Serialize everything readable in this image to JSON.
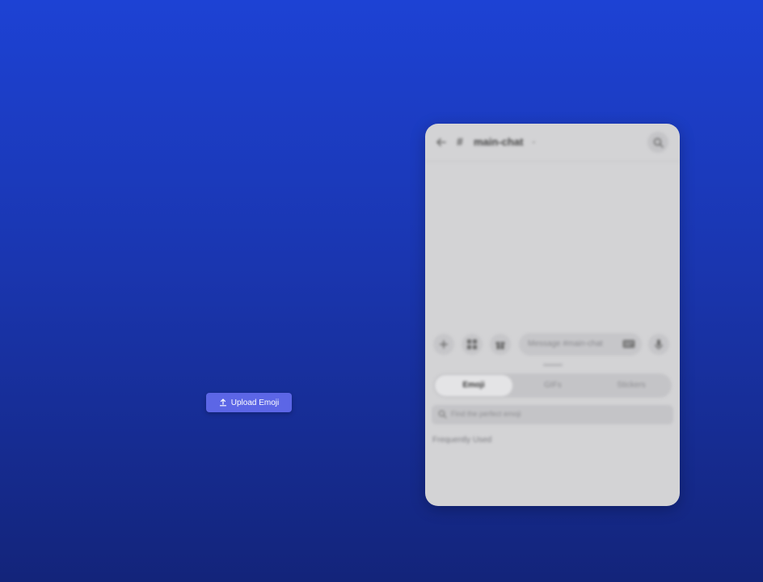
{
  "upload": {
    "label": "Upload Emoji"
  },
  "preview": {
    "header": {
      "hash": "#",
      "channel": "main-chat",
      "chevron": "⌄"
    },
    "composer": {
      "placeholder": "Message #main-chat"
    },
    "tabs": [
      {
        "label": "Emoji",
        "active": true
      },
      {
        "label": "GIFs",
        "active": false
      },
      {
        "label": "Stickers",
        "active": false
      }
    ],
    "emoji_search": {
      "placeholder": "Find the perfect emoji"
    },
    "section_label": "Frequently Used"
  },
  "colors": {
    "accent": "#5c66e6",
    "background_top": "#1d42d4",
    "background_bottom": "#13247a",
    "panel": "#d3d3d5"
  },
  "icons": [
    "upload-icon",
    "back-arrow-icon",
    "hash-icon",
    "search-icon",
    "plus-icon",
    "apps-icon",
    "gift-box-icon",
    "mic-icon",
    "gif-icon"
  ]
}
